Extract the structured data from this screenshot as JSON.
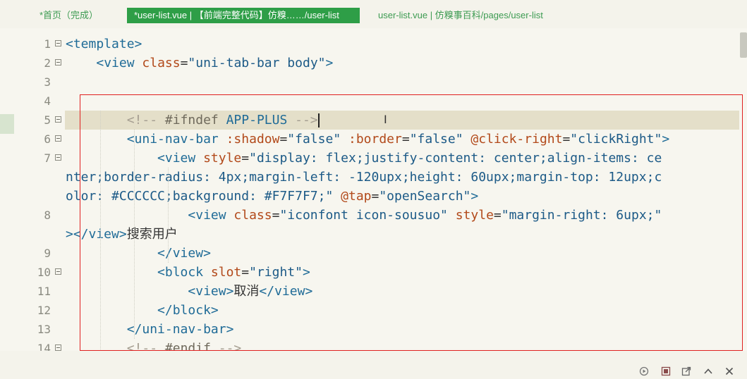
{
  "tabs": [
    {
      "label": "*首页（完成）",
      "active": false
    },
    {
      "label": "*user-list.vue | 【前端完整代码】仿糗……/user-list",
      "active": true
    },
    {
      "label": "user-list.vue | 仿糗事百科/pages/user-list",
      "active": false
    }
  ],
  "editor": {
    "lines": [
      {
        "num": "1",
        "fold": true,
        "segs": [
          [
            "tag",
            "<template>"
          ]
        ]
      },
      {
        "num": "2",
        "fold": true,
        "segs": [
          [
            "txt",
            "    "
          ],
          [
            "tag",
            "<view "
          ],
          [
            "attr",
            "class"
          ],
          [
            "txt",
            "="
          ],
          [
            "str",
            "\"uni-tab-bar body\""
          ],
          [
            "tag",
            ">"
          ]
        ]
      },
      {
        "num": "3",
        "fold": false,
        "segs": []
      },
      {
        "num": "4",
        "fold": false,
        "segs": []
      },
      {
        "num": "5",
        "fold": true,
        "current": true,
        "segs": [
          [
            "txt",
            "        "
          ],
          [
            "cmt",
            "<!-- "
          ],
          [
            "cmtkw",
            "#ifndef "
          ],
          [
            "tag",
            "APP-PLUS"
          ],
          [
            "cmt",
            " -->"
          ]
        ]
      },
      {
        "num": "6",
        "fold": true,
        "segs": [
          [
            "txt",
            "        "
          ],
          [
            "tag",
            "<uni-nav-bar "
          ],
          [
            "attr",
            ":shadow"
          ],
          [
            "txt",
            "="
          ],
          [
            "str",
            "\"false\""
          ],
          [
            "txt",
            " "
          ],
          [
            "attr",
            ":border"
          ],
          [
            "txt",
            "="
          ],
          [
            "str",
            "\"false\""
          ],
          [
            "txt",
            " "
          ],
          [
            "attr",
            "@click-right"
          ],
          [
            "txt",
            "="
          ],
          [
            "str",
            "\"clickRight\""
          ],
          [
            "tag",
            ">"
          ]
        ]
      },
      {
        "num": "7",
        "fold": true,
        "segs": [
          [
            "txt",
            "            "
          ],
          [
            "tag",
            "<view "
          ],
          [
            "attr",
            "style"
          ],
          [
            "txt",
            "="
          ],
          [
            "str",
            "\"display: flex;justify-content: center;align-items: ce"
          ]
        ]
      },
      {
        "num": "",
        "fold": false,
        "segs": [
          [
            "str",
            "nter;border-radius: 4px;margin-left: -120upx;height: 60upx;margin-top: 12upx;c"
          ]
        ]
      },
      {
        "num": "",
        "fold": false,
        "segs": [
          [
            "str",
            "olor: #CCCCCC;background: #F7F7F7;\""
          ],
          [
            "txt",
            " "
          ],
          [
            "attr",
            "@tap"
          ],
          [
            "txt",
            "="
          ],
          [
            "str",
            "\"openSearch\""
          ],
          [
            "tag",
            ">"
          ]
        ]
      },
      {
        "num": "8",
        "fold": false,
        "segs": [
          [
            "txt",
            "                "
          ],
          [
            "tag",
            "<view "
          ],
          [
            "attr",
            "class"
          ],
          [
            "txt",
            "="
          ],
          [
            "str",
            "\"iconfont icon-sousuo\""
          ],
          [
            "txt",
            " "
          ],
          [
            "attr",
            "style"
          ],
          [
            "txt",
            "="
          ],
          [
            "str",
            "\"margin-right: 6upx;\""
          ]
        ]
      },
      {
        "num": "",
        "fold": false,
        "segs": [
          [
            "tag",
            "></view>"
          ],
          [
            "txt",
            "搜索用户"
          ]
        ]
      },
      {
        "num": "9",
        "fold": false,
        "segs": [
          [
            "txt",
            "            "
          ],
          [
            "tag",
            "</view>"
          ]
        ]
      },
      {
        "num": "10",
        "fold": true,
        "segs": [
          [
            "txt",
            "            "
          ],
          [
            "tag",
            "<block "
          ],
          [
            "attr",
            "slot"
          ],
          [
            "txt",
            "="
          ],
          [
            "str",
            "\"right\""
          ],
          [
            "tag",
            ">"
          ]
        ]
      },
      {
        "num": "11",
        "fold": false,
        "segs": [
          [
            "txt",
            "                "
          ],
          [
            "tag",
            "<view>"
          ],
          [
            "txt",
            "取消"
          ],
          [
            "tag",
            "</view>"
          ]
        ]
      },
      {
        "num": "12",
        "fold": false,
        "segs": [
          [
            "txt",
            "            "
          ],
          [
            "tag",
            "</block>"
          ]
        ]
      },
      {
        "num": "13",
        "fold": false,
        "segs": [
          [
            "txt",
            "        "
          ],
          [
            "tag",
            "</uni-nav-bar>"
          ]
        ]
      },
      {
        "num": "14",
        "fold": true,
        "segs": [
          [
            "txt",
            "        "
          ],
          [
            "cmt",
            "<!-- "
          ],
          [
            "cmtkw",
            "#endif"
          ],
          [
            "cmt",
            " -->"
          ]
        ]
      }
    ]
  },
  "colors": {
    "tab_active_bg": "#2e9e47",
    "highlight_box": "#e02020",
    "tag": "#1f6b97",
    "attribute": "#b2491a",
    "string": "#1c5a87"
  },
  "statusbar": {
    "icons": [
      "run-icon",
      "stop-icon",
      "external-window-icon",
      "chevron-up-icon",
      "close-icon"
    ]
  }
}
